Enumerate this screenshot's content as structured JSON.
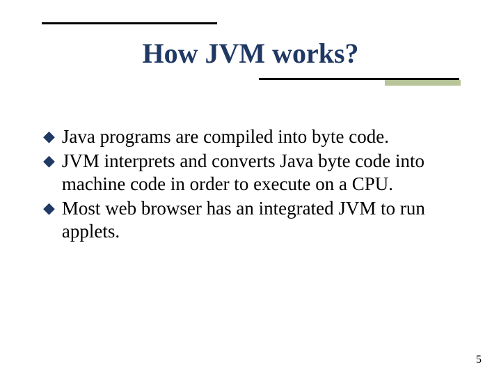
{
  "title": "How JVM works?",
  "bullets": [
    "Java programs are compiled into byte code.",
    "JVM interprets and converts Java byte code into machine code in order to execute on a CPU.",
    "Most web browser has an integrated JVM to run applets."
  ],
  "pageNumber": "5",
  "colors": {
    "titleColor": "#1f3864",
    "accentShadow": "#b7c599"
  }
}
